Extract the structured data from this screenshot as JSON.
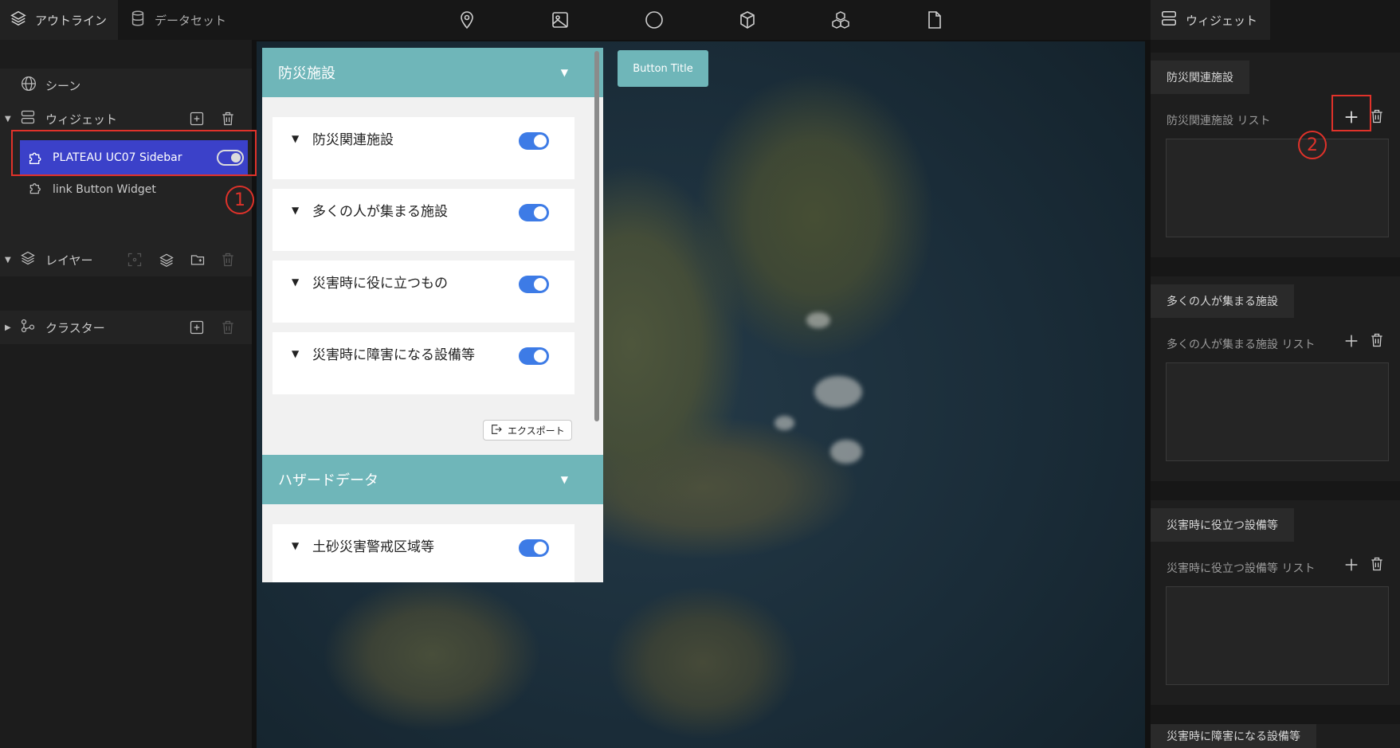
{
  "topbar": {
    "tabs": [
      {
        "label": "アウトライン",
        "icon": "layers-icon",
        "active": true
      },
      {
        "label": "データセット",
        "icon": "database-icon",
        "active": false
      }
    ],
    "tools": [
      "map-pin-icon",
      "image-icon",
      "circle-icon",
      "cube-icon",
      "cubes-icon",
      "file-icon"
    ],
    "right_tab": {
      "label": "ウィジェット",
      "icon": "widget-icon"
    }
  },
  "outline": {
    "scene": {
      "label": "シーン",
      "icon": "globe-icon"
    },
    "widget_group": {
      "label": "ウィジェット",
      "icon": "widget-icon"
    },
    "widgets": [
      {
        "label": "PLATEAU UC07 Sidebar",
        "icon": "puzzle-icon",
        "selected": true,
        "enabled": true
      },
      {
        "label": "link Button Widget",
        "icon": "puzzle-icon",
        "selected": false
      }
    ],
    "layers": {
      "label": "レイヤー",
      "icon": "layers-icon"
    },
    "clusters": {
      "label": "クラスター",
      "icon": "cluster-icon"
    }
  },
  "annotations": {
    "marker1": "1",
    "marker2": "2",
    "color": "#e0322a"
  },
  "sidebar_widget": {
    "sections": [
      {
        "title": "防災施設",
        "arrow": "▼",
        "cards": [
          {
            "title": "防災関連施設",
            "on": true
          },
          {
            "title": "多くの人が集まる施設",
            "on": true
          },
          {
            "title": "災害時に役に立つもの",
            "on": true
          },
          {
            "title": "災害時に障害になる設備等",
            "on": true
          }
        ],
        "export_label": "エクスポート"
      },
      {
        "title": "ハザードデータ",
        "arrow": "▼",
        "cards": [
          {
            "title": "土砂災害警戒区域等",
            "on": true
          }
        ]
      }
    ],
    "accent": "#6fb6b9",
    "toggle_color": "#3d7be6"
  },
  "button_widget": {
    "label": "Button Title"
  },
  "right_panel": {
    "sections": [
      {
        "tab": "防災関連施設",
        "list_label": "防災関連施設 リスト"
      },
      {
        "tab": "多くの人が集まる施設",
        "list_label": "多くの人が集まる施設 リスト"
      },
      {
        "tab": "災害時に役立つ設備等",
        "list_label": "災害時に役立つ設備等 リスト"
      },
      {
        "tab": "災害時に障害になる設備等"
      }
    ]
  }
}
